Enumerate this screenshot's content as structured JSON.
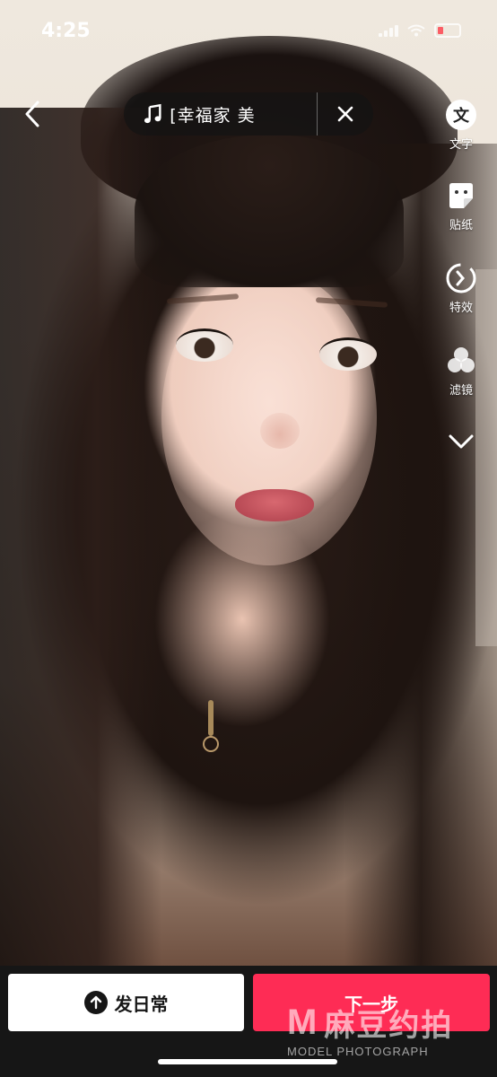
{
  "status_bar": {
    "time": "4:25"
  },
  "music": {
    "title": "[幸福家       美"
  },
  "toolbar": {
    "items": [
      {
        "label": "文字",
        "icon": "text-icon"
      },
      {
        "label": "贴纸",
        "icon": "sticker-icon"
      },
      {
        "label": "特效",
        "icon": "effects-icon"
      },
      {
        "label": "滤镜",
        "icon": "filter-icon"
      }
    ],
    "text_glyph": "文"
  },
  "actions": {
    "daily_label": "发日常",
    "next_label": "下一步"
  },
  "watermark": {
    "cn": "麻豆约拍",
    "letter": "M",
    "en": "MODEL PHOTOGRAPH"
  },
  "colors": {
    "accent": "#fe2c55",
    "bottom_bg": "#161616"
  }
}
